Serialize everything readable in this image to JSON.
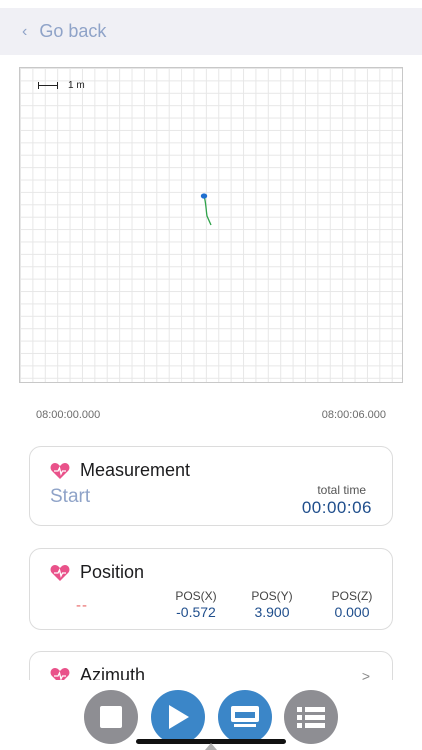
{
  "nav": {
    "back_label": "Go back",
    "back_icon": "chevron-left-icon"
  },
  "map": {
    "scale_label": "1 m",
    "start_time": "08:00:00.000",
    "end_time": "08:00:06.000",
    "track_color": "#2fa24a",
    "marker_color": "#1f6fd0"
  },
  "measurement": {
    "title": "Measurement",
    "state": "Start",
    "total_time_label": "total time",
    "total_time": "00:00:06"
  },
  "position": {
    "title": "Position",
    "placeholder": "--",
    "columns": [
      {
        "label": "POS(X)",
        "value": "-0.572"
      },
      {
        "label": "POS(Y)",
        "value": "3.900"
      },
      {
        "label": "POS(Z)",
        "value": "0.000"
      }
    ]
  },
  "azimuth": {
    "title": "Azimuth"
  },
  "toolbar": {
    "buttons": [
      "stop-icon",
      "play-icon",
      "monitor-icon",
      "list-icon"
    ]
  },
  "colors": {
    "accent": "#3b86c8",
    "muted_button": "#8e8e93",
    "link": "#8fa3c8",
    "value": "#1f4e8c",
    "heart": "#e9528a"
  }
}
